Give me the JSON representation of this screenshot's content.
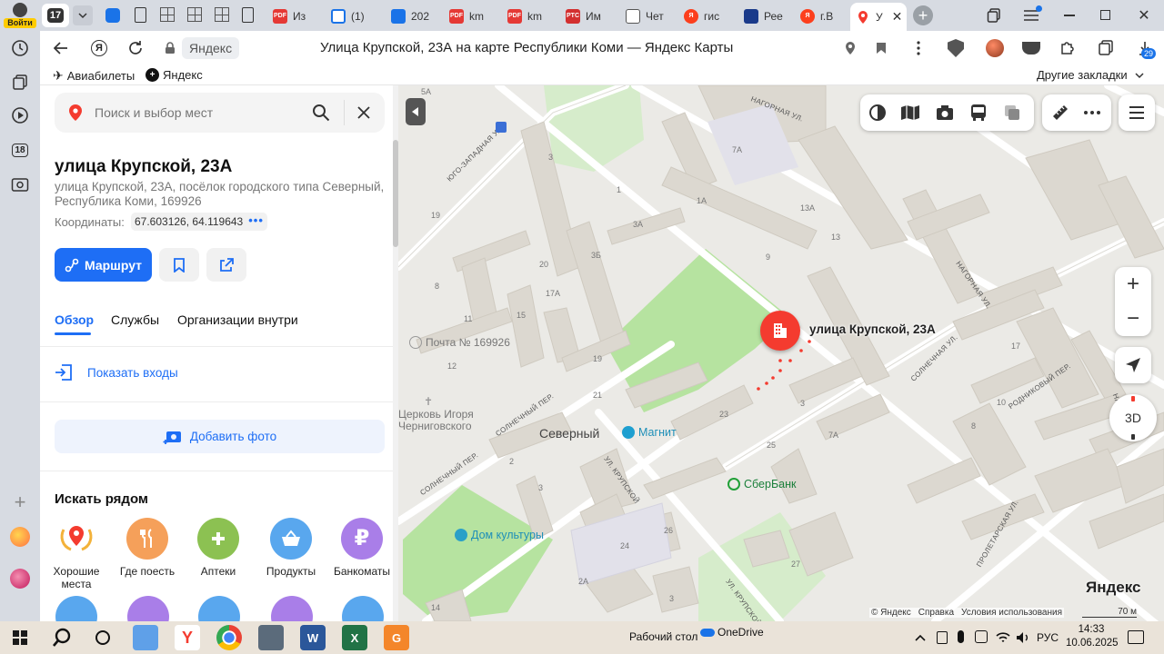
{
  "browser": {
    "login_label": "Войти",
    "tab_count": "17",
    "tabs": [
      {
        "label": "Из",
        "badge": "PDF"
      },
      {
        "label": "(1)"
      },
      {
        "label": "202"
      },
      {
        "label": "km",
        "badge": "PDF"
      },
      {
        "label": "km",
        "badge": "PDF"
      },
      {
        "label": "Им",
        "badge": "PTC"
      },
      {
        "label": "Чет"
      },
      {
        "label": "гис",
        "badge": "Я"
      },
      {
        "label": "Рее"
      },
      {
        "label": "г.В",
        "badge": "Я"
      },
      {
        "label": "У"
      }
    ],
    "address_chip": "Яндекс",
    "page_title": "Улица Крупской, 23А на карте Республики Коми — Яндекс Карты",
    "downloads_badge": "29",
    "bookmarks": [
      {
        "label": "Авиабилеты"
      },
      {
        "label": "Яндекс"
      }
    ],
    "other_bookmarks": "Другие закладки",
    "rail_badge": "18"
  },
  "panel": {
    "search_placeholder": "Поиск и выбор мест",
    "title": "улица Крупской, 23А",
    "address": "улица Крупской, 23А, посёлок городского типа Северный, Республика Коми, 169926",
    "coords_label": "Координаты:",
    "coords_value": "67.603126, 64.119643",
    "route_label": "Маршрут",
    "tabs": [
      "Обзор",
      "Службы",
      "Организации внутри"
    ],
    "entrances_label": "Показать входы",
    "add_photo_label": "Добавить фото",
    "nearby_title": "Искать рядом",
    "categories": [
      {
        "label": "Хорошие места",
        "color": "#ffffff"
      },
      {
        "label": "Где поесть",
        "color": "#f5a05a"
      },
      {
        "label": "Аптеки",
        "color": "#8cc152"
      },
      {
        "label": "Продукты",
        "color": "#59a7ee"
      },
      {
        "label": "Банкоматы",
        "color": "#a97ee8"
      }
    ],
    "categories_row2_colors": [
      "#59a7ee",
      "#a97ee8",
      "#59a7ee",
      "#a97ee8",
      "#59a7ee"
    ]
  },
  "map": {
    "pin_label": "улица Крупской, 23А",
    "streets": [
      "НАГОРНАЯ УЛ.",
      "ЮГО-ЗАПАДНАЯ УЛ.",
      "НАГОРНАЯ УЛ.",
      "СОЛНЕЧНАЯ УЛ.",
      "СОЛНЕЧНЫЙ ПЕР.",
      "УЛ. КРУПСКОЙ",
      "СОЛНЕЧНЫЙ ПЕР.",
      "РОДНИКОВЫЙ ПЕР.",
      "ПРОЛЕТАРСКАЯ УЛ.",
      "УЛ. КРУПСКОЙ",
      "НАГ"
    ],
    "numbers": [
      "5А",
      "7А",
      "3",
      "1",
      "1А",
      "13А",
      "3А",
      "13",
      "19",
      "3Б",
      "9",
      "20",
      "17А",
      "8",
      "15",
      "11",
      "12",
      "19",
      "21",
      "23",
      "3",
      "25",
      "7А",
      "17",
      "10",
      "8",
      "2",
      "3",
      "26",
      "24",
      "2А",
      "27",
      "14",
      "3"
    ],
    "pois": {
      "post": "Почта № 169926",
      "church": "Церковь Игоря Черниговского",
      "town": "Северный",
      "magnit": "Магнит",
      "sber": "СберБанк",
      "culture": "Дом культуры"
    },
    "zoom_in": "+",
    "zoom_out": "−",
    "btn_3d": "3D",
    "copyright": "© Яндекс",
    "help": "Справка",
    "terms": "Условия использования",
    "scale": "70 м",
    "logo": "Яндекс"
  },
  "taskbar": {
    "desktop_label": "Рабочий стол",
    "onedrive_label": "OneDrive",
    "lang": "РУС",
    "time": "14:33",
    "date": "10.06.2025"
  },
  "colors": {
    "accent": "#1e6ef5",
    "pin": "#f43b2f",
    "park": "#b6e3a0"
  }
}
